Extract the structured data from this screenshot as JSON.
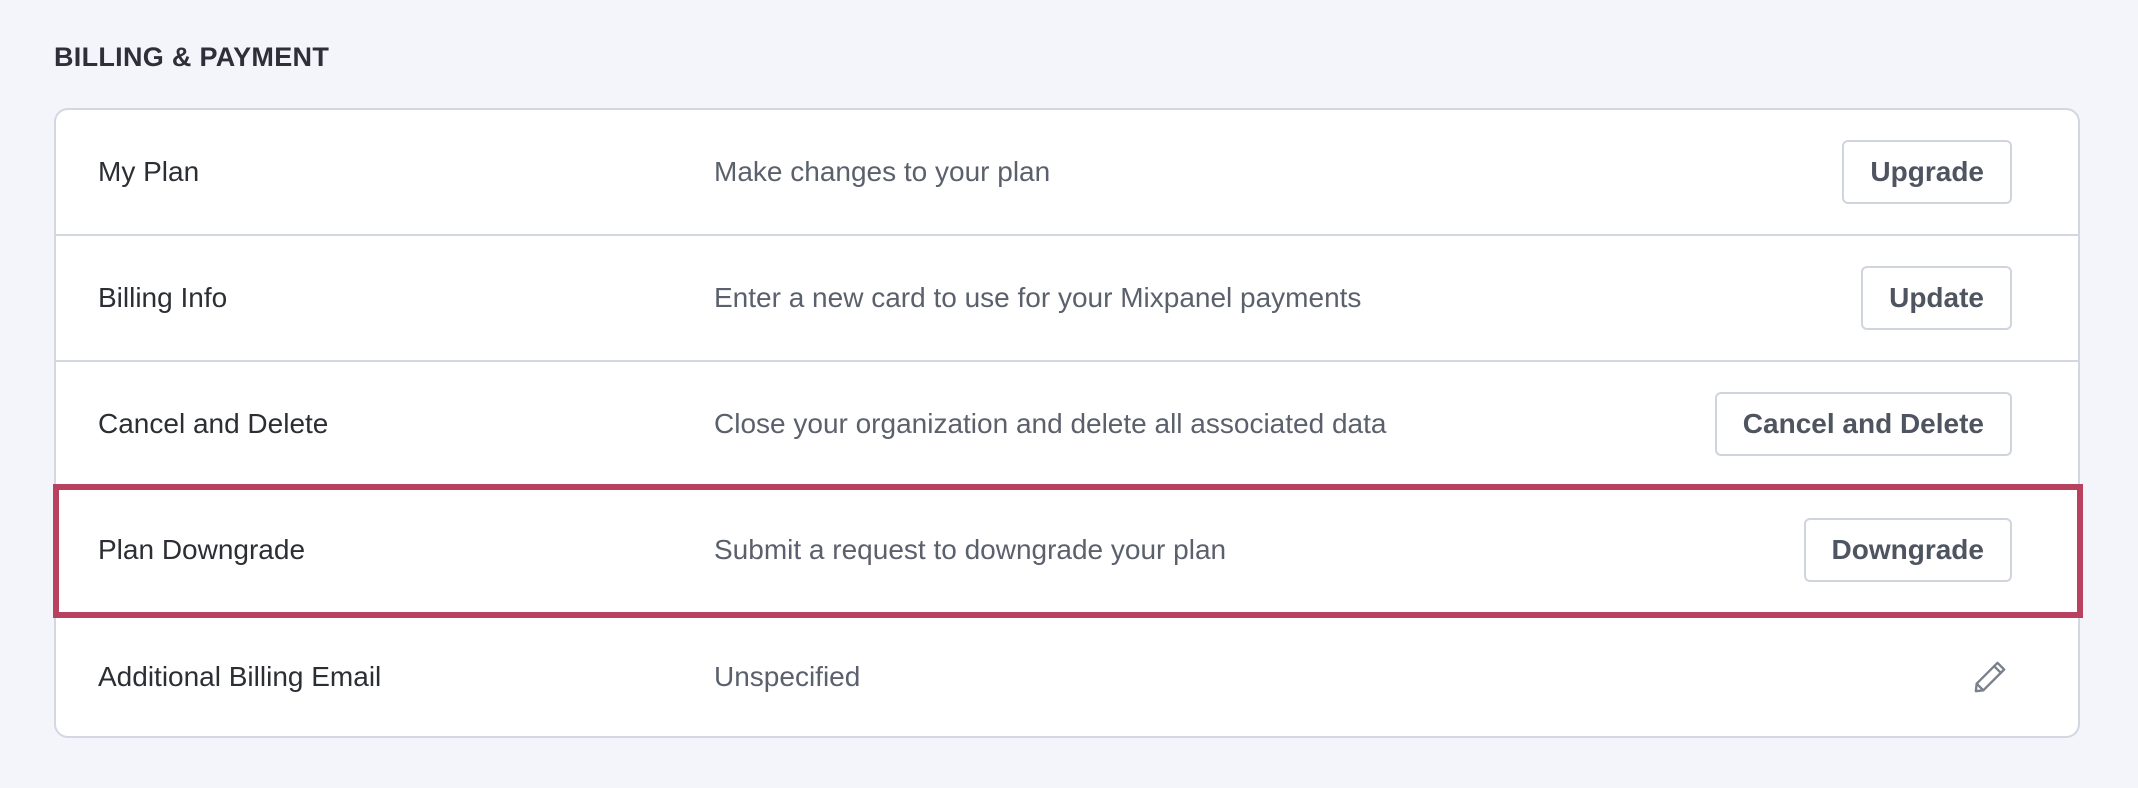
{
  "section": {
    "title": "BILLING & PAYMENT"
  },
  "rows": [
    {
      "label": "My Plan",
      "description": "Make changes to your plan",
      "action_label": "Upgrade"
    },
    {
      "label": "Billing Info",
      "description": "Enter a new card to use for your Mixpanel payments",
      "action_label": "Update"
    },
    {
      "label": "Cancel and Delete",
      "description": "Close your organization and delete all associated data",
      "action_label": "Cancel and Delete"
    },
    {
      "label": "Plan Downgrade",
      "description": "Submit a request to downgrade your plan",
      "action_label": "Downgrade"
    },
    {
      "label": "Additional Billing Email",
      "description": "Unspecified",
      "action_icon": "pencil-icon"
    }
  ],
  "colors": {
    "highlight_border": "#b8415f",
    "background": "#f3f5fa",
    "card_border": "#d3d7e2"
  }
}
